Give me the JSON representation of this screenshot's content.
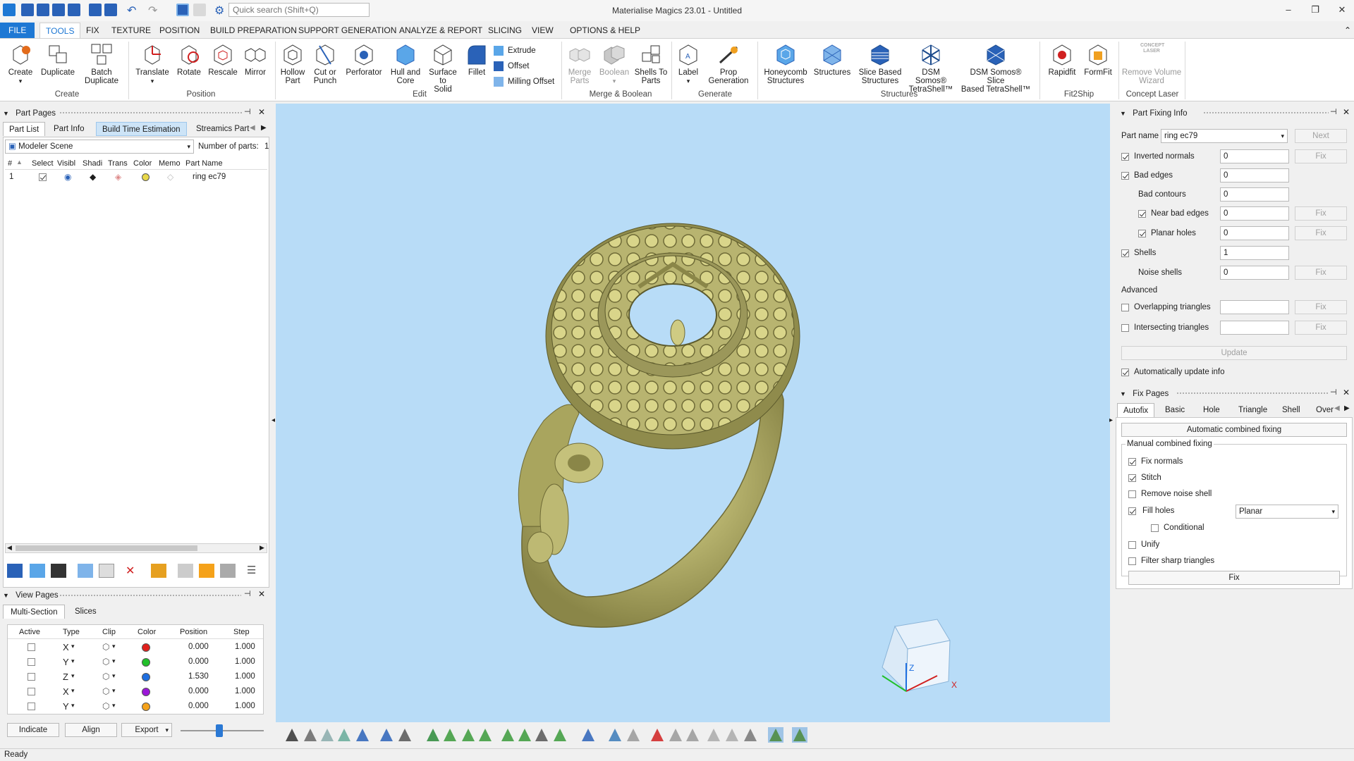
{
  "app": {
    "title": "Materialise Magics 23.01 - Untitled",
    "search_placeholder": "Quick search (Shift+Q)"
  },
  "tabs": [
    {
      "label": "FILE"
    },
    {
      "label": "TOOLS"
    },
    {
      "label": "FIX"
    },
    {
      "label": "TEXTURE"
    },
    {
      "label": "POSITION"
    },
    {
      "label": "BUILD PREPARATION"
    },
    {
      "label": "SUPPORT GENERATION"
    },
    {
      "label": "ANALYZE & REPORT"
    },
    {
      "label": "SLICING"
    },
    {
      "label": "VIEW"
    },
    {
      "label": "OPTIONS & HELP"
    }
  ],
  "ribbon": {
    "create": {
      "group": "Create",
      "create": "Create",
      "duplicate": "Duplicate",
      "batch1": "Batch",
      "batch2": "Duplicate"
    },
    "position": {
      "group": "Position",
      "translate": "Translate",
      "rotate": "Rotate",
      "rescale": "Rescale",
      "mirror": "Mirror"
    },
    "edit": {
      "group": "Edit",
      "hollow1": "Hollow",
      "hollow2": "Part",
      "cut1": "Cut or",
      "cut2": "Punch",
      "perforator": "Perforator",
      "hull1": "Hull and",
      "hull2": "Core",
      "s2s1": "Surface to",
      "s2s2": "Solid",
      "fillet": "Fillet",
      "extrude": "Extrude",
      "offset": "Offset",
      "milling": "Milling Offset"
    },
    "merge": {
      "group": "Merge & Boolean",
      "merge1": "Merge",
      "merge2": "Parts",
      "boolean": "Boolean",
      "shells1": "Shells To",
      "shells2": "Parts"
    },
    "generate": {
      "group": "Generate",
      "label": "Label",
      "prop1": "Prop",
      "prop2": "Generation"
    },
    "structures": {
      "group": "Structures",
      "honey1": "Honeycomb",
      "honey2": "Structures",
      "structures": "Structures",
      "slice1": "Slice Based",
      "slice2": "Structures",
      "dsm1a": "DSM Somos®",
      "dsm1b": "TetraShell™",
      "dsm2a": "DSM Somos® Slice",
      "dsm2b": "Based TetraShell™"
    },
    "fit2ship": {
      "group": "Fit2Ship",
      "rapidfit": "Rapidfit",
      "formfit": "FormFit"
    },
    "concept": {
      "group": "Concept Laser",
      "remove1": "Remove Volume",
      "remove2": "Wizard",
      "logo": "CONCEPT LASER"
    }
  },
  "part_pages": {
    "title": "Part Pages",
    "tabs": [
      "Part List",
      "Part Info",
      "Build Time Estimation",
      "Streamics Part"
    ],
    "scene": "Modeler Scene",
    "num_parts_label": "Number of parts:",
    "num_parts": "1",
    "columns": [
      "#",
      "Select",
      "Visibl",
      "Shadi",
      "Trans",
      "Color",
      "Memo",
      "Part Name"
    ],
    "rows": [
      {
        "num": "1",
        "name": "ring ec79"
      }
    ]
  },
  "view_pages": {
    "title": "View Pages",
    "tabs": [
      "Multi-Section",
      "Slices"
    ],
    "columns": [
      "Active",
      "Type",
      "Clip",
      "Color",
      "Position",
      "Step"
    ],
    "rows": [
      {
        "type": "X",
        "color": "#e0201c",
        "position": "0.000",
        "step": "1.000"
      },
      {
        "type": "Y",
        "color": "#22c02a",
        "position": "0.000",
        "step": "1.000"
      },
      {
        "type": "Z",
        "color": "#1f6fe0",
        "position": "1.530",
        "step": "1.000"
      },
      {
        "type": "X",
        "color": "#9b17d8",
        "position": "0.000",
        "step": "1.000"
      },
      {
        "type": "Y",
        "color": "#f5a21a",
        "position": "0.000",
        "step": "1.000"
      }
    ],
    "indicate": "Indicate",
    "align": "Align",
    "export": "Export"
  },
  "part_fixing": {
    "title": "Part Fixing Info",
    "part_name_label": "Part name",
    "part_name": "ring ec79",
    "next": "Next",
    "fix": "Fix",
    "inverted_normals": {
      "label": "Inverted normals",
      "value": "0"
    },
    "bad_edges": {
      "label": "Bad edges",
      "value": "0"
    },
    "bad_contours": {
      "label": "Bad contours",
      "value": "0"
    },
    "near_bad_edges": {
      "label": "Near bad edges",
      "value": "0"
    },
    "planar_holes": {
      "label": "Planar holes",
      "value": "0"
    },
    "shells": {
      "label": "Shells",
      "value": "1"
    },
    "noise_shells": {
      "label": "Noise shells",
      "value": "0"
    },
    "advanced": "Advanced",
    "overlapping": "Overlapping triangles",
    "intersecting": "Intersecting triangles",
    "update": "Update",
    "auto_update": "Automatically update info"
  },
  "fix_pages": {
    "title": "Fix Pages",
    "tabs": [
      "Autofix",
      "Basic",
      "Hole",
      "Triangle",
      "Shell",
      "Over"
    ],
    "auto_combined": "Automatic combined fixing",
    "manual_group": "Manual combined fixing",
    "fix_normals": "Fix normals",
    "stitch": "Stitch",
    "remove_noise": "Remove noise shell",
    "fill_holes": "Fill holes",
    "fill_mode": "Planar",
    "conditional": "Conditional",
    "unify": "Unify",
    "filter_sharp": "Filter sharp triangles",
    "fix_btn": "Fix"
  },
  "axes": {
    "z": "Z",
    "x": "X"
  },
  "status": "Ready",
  "colors": {
    "accent": "#1e78d4",
    "viewport": "#b8dcf7",
    "ring": "#b8b66c"
  }
}
